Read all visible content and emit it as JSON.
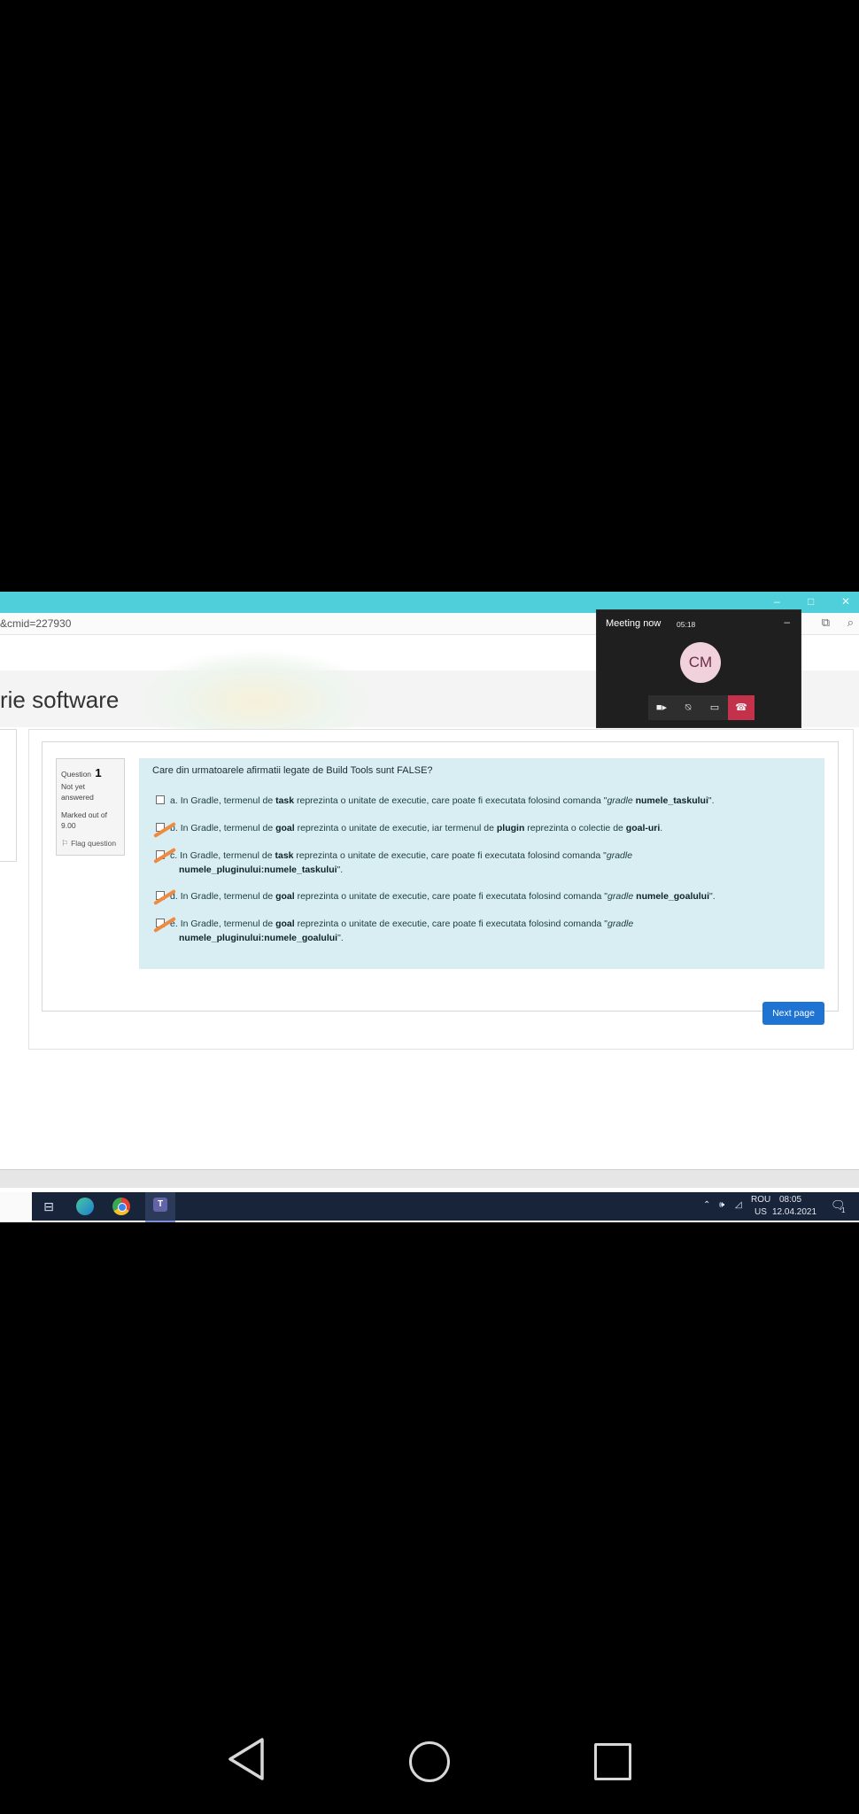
{
  "browser": {
    "url_fragment": "&cmid=227930",
    "window_controls": [
      "–",
      "□",
      "✕"
    ],
    "translate_icon": "translate-icon",
    "zoom_icon": "zoom-icon"
  },
  "course": {
    "title": "rie software"
  },
  "question_info": {
    "label": "Question",
    "number": "1",
    "status": "Not yet answered",
    "marked_out_of": "Marked out of 9.00",
    "flag_label": "Flag question"
  },
  "question": {
    "text": "Care din urmatoarele afirmatii legate de Build Tools sunt FALSE?",
    "options": [
      {
        "letter": "a.",
        "pre": "In Gradle, termenul de ",
        "b1": "task",
        "mid": " reprezinta o unitate de executie, care poate fi executata folosind comanda \"",
        "i1": "gradle",
        "sp": " ",
        "b2": "numele_taskului",
        "end": "\".",
        "cont": "",
        "hand_marked": false
      },
      {
        "letter": "b.",
        "pre": "In Gradle, termenul de ",
        "b1": "goal",
        "mid": " reprezinta o unitate de executie, iar termenul de ",
        "b2": "plugin",
        "mid2": " reprezinta o colectie de ",
        "b3": "goal-uri",
        "end": ".",
        "hand_marked": true
      },
      {
        "letter": "c.",
        "pre": "In Gradle, termenul de ",
        "b1": "task",
        "mid": " reprezinta o unitate de executie, care poate fi executata folosind comanda \"",
        "i1": "gradle",
        "cont_b": "numele_pluginului:numele_taskului",
        "cont_end": "\".",
        "hand_marked": true
      },
      {
        "letter": "d.",
        "pre": "In Gradle, termenul de ",
        "b1": "goal",
        "mid": " reprezinta o unitate de executie, care poate fi executata folosind comanda \"",
        "i1": "gradle",
        "sp": " ",
        "b2": "numele_goalului",
        "end": "\".",
        "hand_marked": true
      },
      {
        "letter": "e.",
        "pre": "In Gradle, termenul de ",
        "b1": "goal",
        "mid": " reprezinta o unitate de executie, care poate fi executata folosind comanda \"",
        "i1": "gradle",
        "cont_b": "numele_pluginului:numele_goalului",
        "cont_end": "\".",
        "hand_marked": true
      }
    ],
    "mark_color": "#ef8a3e"
  },
  "navigation": {
    "next_label": "Next page"
  },
  "meeting": {
    "title": "Meeting now",
    "time": "05:18",
    "minimize": "–",
    "avatar_initials": "CM",
    "controls": [
      "video-icon",
      "mic-off-icon",
      "share-icon",
      "hang-up-icon"
    ],
    "hangup_color": "#c4314b"
  },
  "taskbar": {
    "apps": [
      "task-view-icon",
      "edge-icon",
      "chrome-icon",
      "teams-icon"
    ],
    "teams_letter": "T",
    "lang_top": "ROU",
    "lang_bottom": "US",
    "time": "08:05",
    "date": "12.04.2021",
    "notifications": "1"
  },
  "android_nav": [
    "back-icon",
    "home-icon",
    "recent-apps-icon"
  ]
}
